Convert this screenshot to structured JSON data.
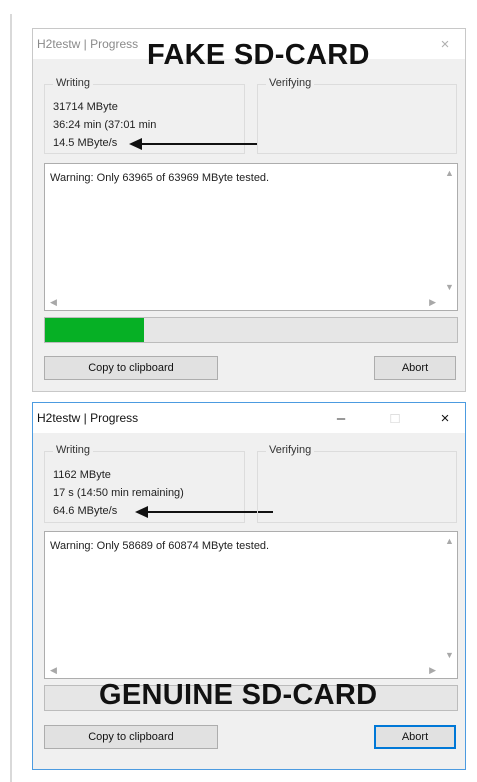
{
  "windows": [
    {
      "title": "H2testw | Progress",
      "overlay_label": "FAKE SD-CARD",
      "writing": {
        "legend": "Writing",
        "written": "31714 MByte",
        "time": "36:24 min (37:01 min",
        "speed": "14.5 MByte/s"
      },
      "verifying": {
        "legend": "Verifying"
      },
      "log_text": "Warning: Only 63965 of 63969 MByte tested.",
      "progress_fraction": 0.24,
      "copy_label": "Copy to clipboard",
      "abort_label": "Abort"
    },
    {
      "title": "H2testw | Progress",
      "overlay_label": "GENUINE SD-CARD",
      "writing": {
        "legend": "Writing",
        "written": "1162 MByte",
        "time": "17 s (14:50 min remaining)",
        "speed": "64.6 MByte/s"
      },
      "verifying": {
        "legend": "Verifying"
      },
      "log_text": "Warning: Only 58689 of 60874 MByte tested.",
      "progress_fraction": 0.0,
      "copy_label": "Copy to clipboard",
      "abort_label": "Abort"
    }
  ],
  "icons": {
    "close": "×",
    "minimize": "–",
    "maximize": "□"
  }
}
